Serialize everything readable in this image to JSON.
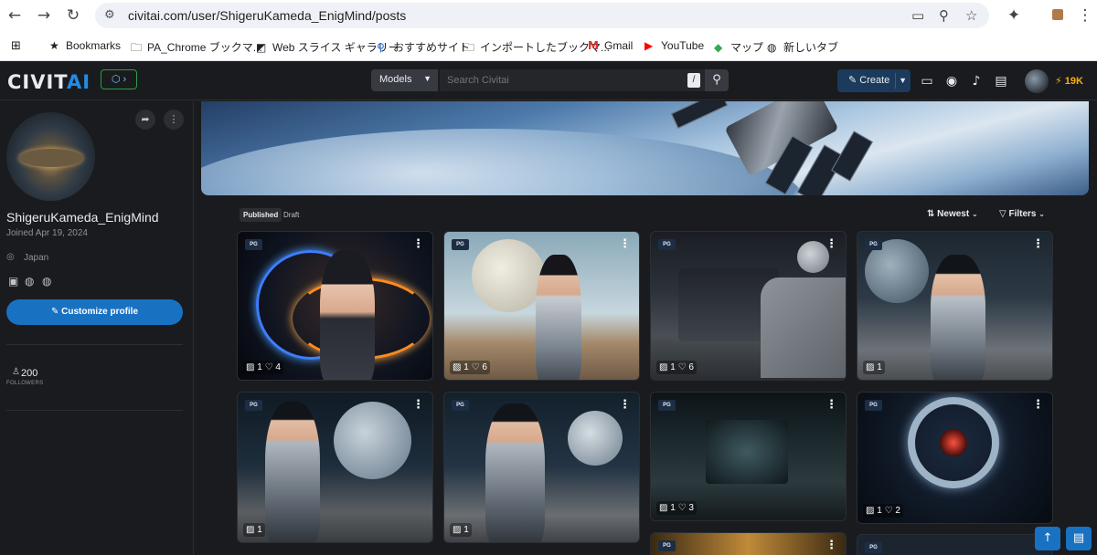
{
  "browser": {
    "url": "civitai.com/user/ShigeruKameda_EnigMind/posts",
    "bookmarks": [
      {
        "label": "Bookmarks",
        "icon": "star-icon"
      },
      {
        "label": "PA_Chrome ブックマ...",
        "icon": "folder-icon"
      },
      {
        "label": "Web スライス ギャラリー",
        "icon": "web-slice-icon"
      },
      {
        "label": "おすすめサイト",
        "icon": "search-icon"
      },
      {
        "label": "インポートしたブックマ...",
        "icon": "folder-icon"
      },
      {
        "label": "Gmail",
        "icon": "gmail-icon"
      },
      {
        "label": "YouTube",
        "icon": "youtube-icon"
      },
      {
        "label": "マップ",
        "icon": "maps-icon"
      },
      {
        "label": "新しいタブ",
        "icon": "globe-icon"
      }
    ]
  },
  "header": {
    "logo_main": "CIVIT",
    "logo_accent": "AI",
    "search_scope": "Models",
    "search_placeholder": "Search Civitai",
    "search_shortcut": "/",
    "create_label": "Create",
    "buzz_amount": "19K",
    "accent_color": "#228be6",
    "buzz_color": "#fab005"
  },
  "profile": {
    "username": "ShigeruKameda_EnigMind",
    "joined": "Joined Apr 19, 2024",
    "location": "Japan",
    "customize_label": "Customize profile",
    "followers_count": "200",
    "followers_label": "FOLLOWERS"
  },
  "posts": {
    "tabs": [
      {
        "label": "Published",
        "active": true
      },
      {
        "label": "Draft",
        "active": false
      }
    ],
    "sort_label": "Newest",
    "filters_label": "Filters",
    "cards": [
      {
        "rating": "PG",
        "images": "1",
        "likes": "4"
      },
      {
        "rating": "PG",
        "images": "1",
        "likes": "6"
      },
      {
        "rating": "PG",
        "images": "1",
        "likes": "6"
      },
      {
        "rating": "PG",
        "images": "1",
        "likes": ""
      },
      {
        "rating": "PG",
        "images": "1",
        "likes": ""
      },
      {
        "rating": "PG",
        "images": "1",
        "likes": ""
      },
      {
        "rating": "PG",
        "images": "1",
        "likes": "3"
      },
      {
        "rating": "PG",
        "images": "1",
        "likes": "2"
      },
      {
        "rating": "PG"
      },
      {
        "rating": "PG"
      }
    ]
  }
}
